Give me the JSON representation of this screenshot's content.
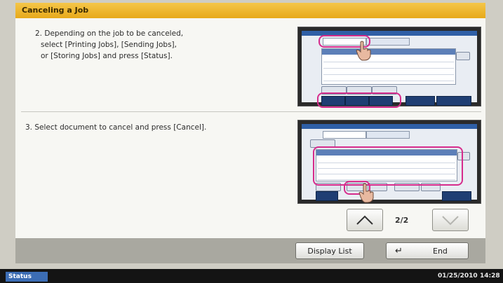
{
  "title": "Canceling a Job",
  "steps": [
    {
      "lines": [
        "2. Depending on the job to be canceled,",
        "select [Printing Jobs], [Sending Jobs],",
        "or [Storing Jobs] and press [Status]."
      ]
    },
    {
      "lines": [
        "3. Select document to cancel and press [Cancel]."
      ]
    }
  ],
  "pagination": {
    "indicator": "2/2",
    "up_icon": "chevron-up-icon",
    "down_icon": "chevron-down-icon"
  },
  "bottom": {
    "display_list_label": "Display List",
    "end_label": "End",
    "end_icon": "enter-icon"
  },
  "statusbar": {
    "status_label": "Status",
    "date": "01/25/2010",
    "time": "14:28"
  },
  "colors": {
    "title_bar": "#e7a91a",
    "highlight": "#d62c8c",
    "status_button": "#3c6db4"
  }
}
